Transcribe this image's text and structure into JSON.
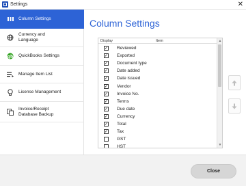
{
  "window": {
    "title": "Settings",
    "close_glyph": "✕"
  },
  "sidebar": {
    "items": [
      {
        "label": "Column Settings",
        "icon": "columns-icon",
        "active": true
      },
      {
        "label": "Currency and\nLanguage",
        "icon": "globe-icon",
        "active": false
      },
      {
        "label": "QuickBooks Settings",
        "icon": "quickbooks-icon",
        "active": false
      },
      {
        "label": "Manage Item List",
        "icon": "list-icon",
        "active": false
      },
      {
        "label": "License Management",
        "icon": "license-icon",
        "active": false
      },
      {
        "label": "Invoice/Receipt\nDatabase Backup",
        "icon": "database-icon",
        "active": false
      }
    ]
  },
  "main": {
    "title": "Column Settings"
  },
  "table": {
    "headers": {
      "display": "Display",
      "item": "Item"
    },
    "rows": [
      {
        "item": "Reviewed",
        "checked": true
      },
      {
        "item": "Exported",
        "checked": true
      },
      {
        "item": "Document type",
        "checked": true
      },
      {
        "item": "Date added",
        "checked": true
      },
      {
        "item": "Date issued",
        "checked": true
      },
      {
        "item": "Vendor",
        "checked": true
      },
      {
        "item": "Invoice No.",
        "checked": true
      },
      {
        "item": "Terms",
        "checked": true
      },
      {
        "item": "Due date",
        "checked": true
      },
      {
        "item": "Currency",
        "checked": true
      },
      {
        "item": "Total",
        "checked": true
      },
      {
        "item": "Tax",
        "checked": true
      },
      {
        "item": "GST",
        "checked": false
      },
      {
        "item": "HST",
        "checked": false
      }
    ]
  },
  "actions": {
    "move_up_icon": "arrow-up-icon",
    "move_down_icon": "arrow-down-icon",
    "close_label": "Close"
  },
  "colors": {
    "accent": "#2d63d6",
    "footer_bg": "#f2f2f2",
    "close_button_bg": "#d6d6d6"
  }
}
